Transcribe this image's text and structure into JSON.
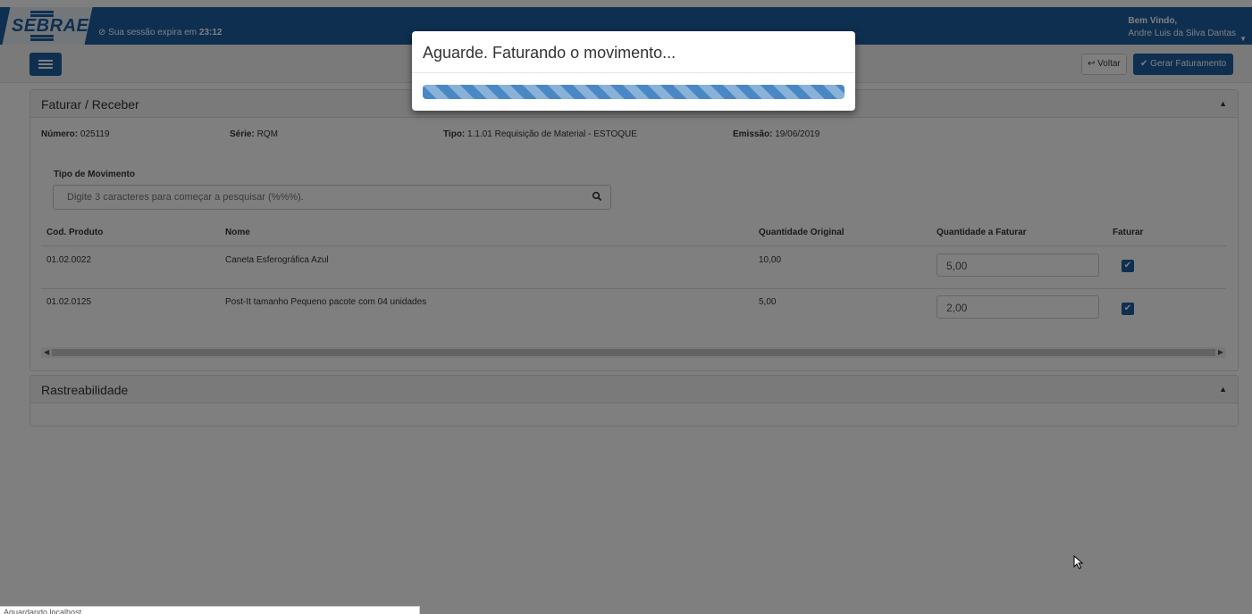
{
  "header": {
    "logo": "SEBRAE",
    "session_prefix": "Sua sessão expira em",
    "session_time": "23:12",
    "welcome": "Bem Vindo,",
    "user_name": "Andre Luis da Silva Dantas"
  },
  "toolbar": {
    "back_label": "Voltar",
    "generate_label": "Gerar Faturamento"
  },
  "faturar": {
    "title": "Faturar / Receber",
    "numero_label": "Número:",
    "numero": "025119",
    "serie_label": "Série:",
    "serie": "RQM",
    "tipo_label": "Tipo:",
    "tipo": "1.1.01 Requisição de Material - ESTOQUE",
    "emissao_label": "Emissão:",
    "emissao": "19/06/2019",
    "tipo_movimento_label": "Tipo de Movimento",
    "search_placeholder": "Digite 3 caracteres para começar a pesquisar (%%%).",
    "columns": [
      "Cod. Produto",
      "Nome",
      "Quantidade Original",
      "Quantidade a Faturar",
      "Faturar"
    ],
    "rows": [
      {
        "codigo": "01.02.0022",
        "nome": "Caneta Esferográfica Azul",
        "qtd_original": "10,00",
        "qtd_faturar": "5,00",
        "faturar": true
      },
      {
        "codigo": "01.02.0125",
        "nome": "Post-It tamanho Pequeno pacote com 04 unidades",
        "qtd_original": "5,00",
        "qtd_faturar": "2,00",
        "faturar": true
      }
    ]
  },
  "rastreabilidade": {
    "title": "Rastreabilidade"
  },
  "modal": {
    "title": "Aguarde. Faturando o movimento...",
    "progress": 1.0
  },
  "statusbar": {
    "text": "Aguardando localhost..."
  },
  "colors": {
    "brand": "#1f5fa0",
    "progress": "#4a88c5"
  }
}
